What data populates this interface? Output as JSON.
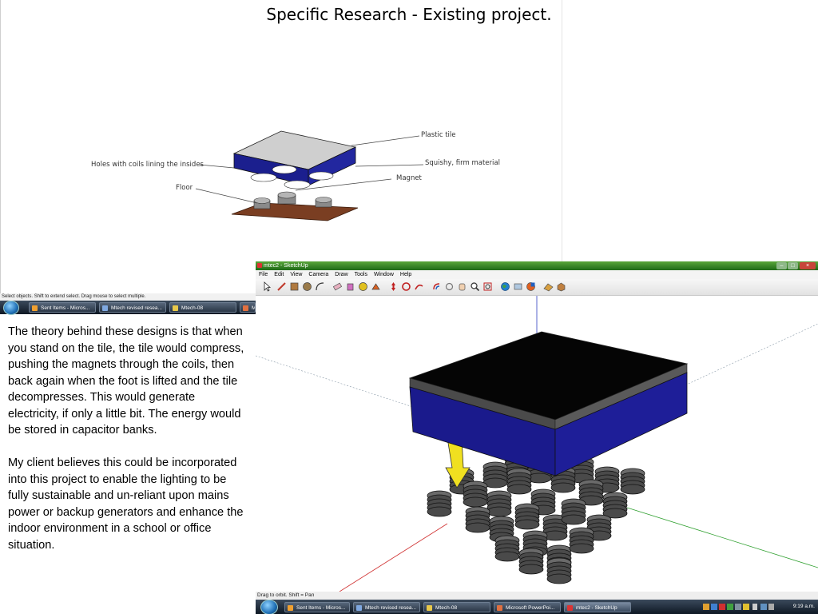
{
  "slide": {
    "title": "Specific Research - Existing project.",
    "paragraphs": [
      "The theory behind these designs is that when you stand on the tile, the tile would compress, pushing the magnets through the coils, then back again when the foot is lifted and the tile decompresses. This would generate electricity, if only a little bit. The energy would be stored in capacitor banks.",
      "My client believes  this could be incorporated into this project to enable the lighting to be fully sustainable and un-reliant upon mains power or backup generators and enhance the indoor environment in a school or office situation."
    ]
  },
  "diagram": {
    "labels": {
      "plastic_tile": "Plastic tile",
      "squishy": "Squishy, firm material",
      "magnet": "Magnet",
      "holes": "Holes with coils lining the insides",
      "floor": "Floor"
    },
    "colors": {
      "tile": "#1b1f8e",
      "floor": "#7a3e22",
      "top": "#cfcfcf"
    }
  },
  "small_screenshot": {
    "status_text": "Select objects. Shift to extend select. Drag mouse to select multiple.",
    "taskbar": [
      {
        "label": "Sent Items - Micros...",
        "icon": "outlook-icon",
        "color": "#f0a030"
      },
      {
        "label": "Mtech revised resea...",
        "icon": "word-icon",
        "color": "#7fa8e0"
      },
      {
        "label": "Mtech-08",
        "icon": "folder-icon",
        "color": "#e8c84a"
      },
      {
        "label": "M",
        "icon": "powerpoint-icon",
        "color": "#e07040"
      }
    ]
  },
  "sketchup": {
    "window_title": "mtec2 - SketchUp",
    "menu": [
      "File",
      "Edit",
      "View",
      "Camera",
      "Draw",
      "Tools",
      "Window",
      "Help"
    ],
    "tools": [
      "select-tool-icon",
      "pencil-tool-icon",
      "rectangle-tool-icon",
      "circle-tool-icon",
      "arc-tool-icon",
      "eraser-tool-icon",
      "paint-bucket-tool-icon",
      "tape-measure-tool-icon",
      "push-pull-tool-icon",
      "move-tool-icon",
      "rotate-tool-icon",
      "follow-me-tool-icon",
      "offset-tool-icon",
      "orbit-tool-icon",
      "pan-tool-icon",
      "zoom-tool-icon",
      "zoom-extents-tool-icon",
      "earth-icon",
      "components-icon",
      "styles-icon",
      "sandbox-icon",
      "3d-warehouse-icon"
    ],
    "status_text": "Drag to orbit.  Shift = Pan",
    "colors": {
      "tile_top": "#050505",
      "tile_side": "#1a1a8c",
      "arrow": "#f0e020",
      "magnet": "#555555"
    },
    "taskbar": [
      {
        "label": "Sent Items - Micros...",
        "icon": "outlook-icon",
        "color": "#f0a030"
      },
      {
        "label": "Mtech revised resea...",
        "icon": "word-icon",
        "color": "#7fa8e0"
      },
      {
        "label": "Mtech-08",
        "icon": "folder-icon",
        "color": "#e8c84a"
      },
      {
        "label": "Microsoft PowerPoi...",
        "icon": "powerpoint-icon",
        "color": "#e07040"
      },
      {
        "label": "mtec2 - SketchUp",
        "icon": "sketchup-icon",
        "color": "#d33"
      }
    ],
    "clock": "9:19 a.m."
  }
}
